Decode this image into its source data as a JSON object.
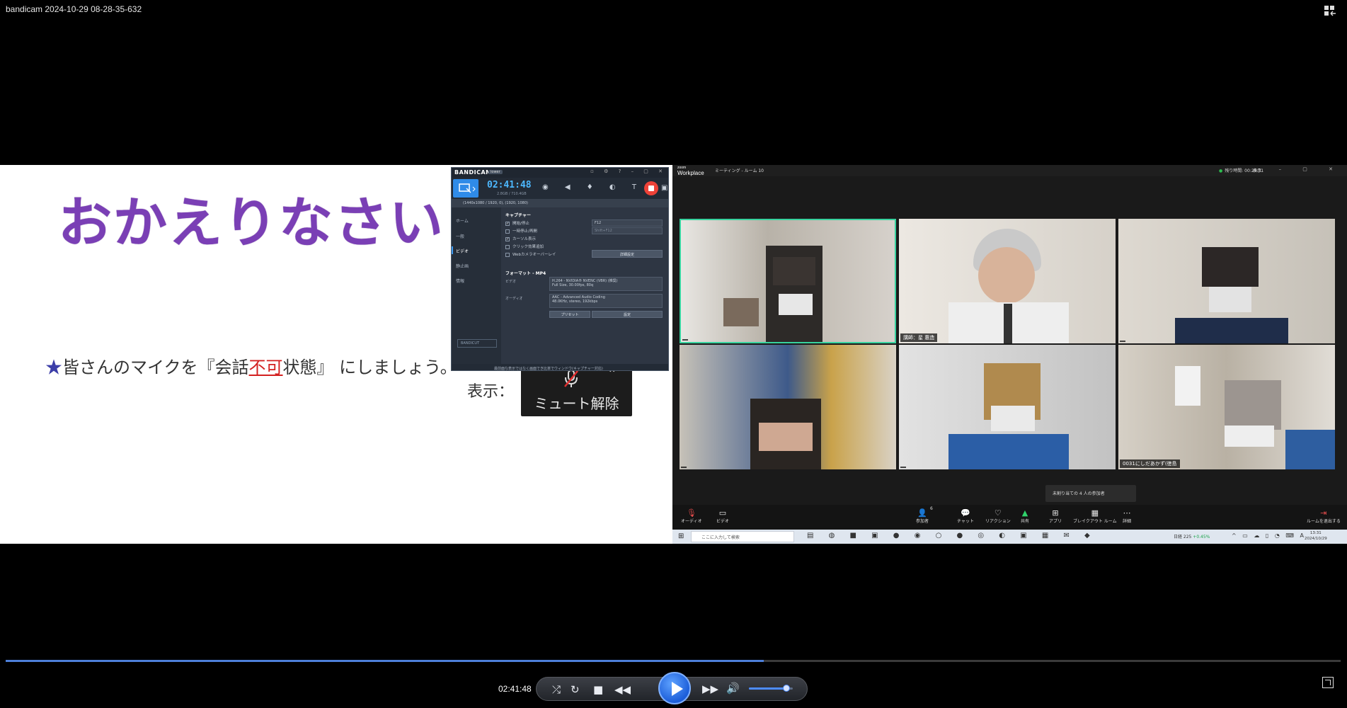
{
  "player": {
    "title": "bandicam 2024-10-29 08-28-35-632",
    "current_time": "02:41:48",
    "progress": 0.568
  },
  "slide": {
    "title": "おかえりなさい！",
    "instruction_star": "★",
    "instruction_pre": "皆さんのマイクを『会話",
    "instruction_red": "不可",
    "instruction_post": "状態』 にしましょう。",
    "display_label": "表示：",
    "unmute_label": "ミュート解除"
  },
  "bandicam": {
    "logo": "BANDICAM",
    "badge": "lower",
    "timer": "02:41:48",
    "size": "2.8GB / 710.4GB",
    "target": "(1440x1080 / 1920, 0), (1920, 1080)",
    "sidebar": [
      "ホーム",
      "一般",
      "ビデオ",
      "静止画",
      "情報"
    ],
    "bandicut": "BANDICUT",
    "capture_heading": "キャプチャー",
    "checkboxes": [
      {
        "label": "開始/停止",
        "checked": true
      },
      {
        "label": "一時停止/再開",
        "checked": false
      },
      {
        "label": "カーソル表示",
        "checked": true
      },
      {
        "label": "クリック効果追加",
        "checked": false
      },
      {
        "label": "Webカメラオーバーレイ",
        "checked": false
      }
    ],
    "hotkey_start": "F12",
    "hotkey_pause": "Shift+F12",
    "advanced_button": "詳細設定",
    "format_heading": "フォーマット - MP4",
    "video_label": "ビデオ",
    "video_line1": "H.264 - NVIDIA® NVENC (VBR) (推奨)",
    "video_line2": "Full Size, 30.00fps, 80q",
    "audio_label": "オーディオ",
    "audio_line1": "AAC - Advanced Audio Coding",
    "audio_line2": "48.0KHz, stereo, 192kbps",
    "preset_button": "プリセット",
    "settings_button": "設定",
    "footer": "最前面な表示ではなく画面でき比率でウィンドウ(キャプチャー対応)"
  },
  "zoom": {
    "logo_small": "zoom",
    "logo": "Workplace",
    "room": "ミーティング - ルーム 10",
    "timer": "残り時間: 00:29:31",
    "view_label": "表示",
    "tiles": [
      {
        "name": ""
      },
      {
        "name": "講師：星 惠造"
      },
      {
        "name": ""
      },
      {
        "name": ""
      },
      {
        "name": ""
      },
      {
        "name": "0031にしだあかず(徳島"
      }
    ],
    "popup": "未割り当ての 4 人の参加者",
    "bar": [
      "オーディオ",
      "ビデオ",
      "参加者",
      "チャット",
      "リアクション",
      "共有",
      "アプリ",
      "ブレイクアウト ルーム",
      "詳細",
      "ルームを退出する"
    ],
    "participants_count": "6",
    "taskbar": {
      "search": "ここに入力して検索",
      "stock": "日経 225",
      "stock_change": "+0.45%",
      "time": "13:31",
      "date": "2024/10/29"
    }
  }
}
